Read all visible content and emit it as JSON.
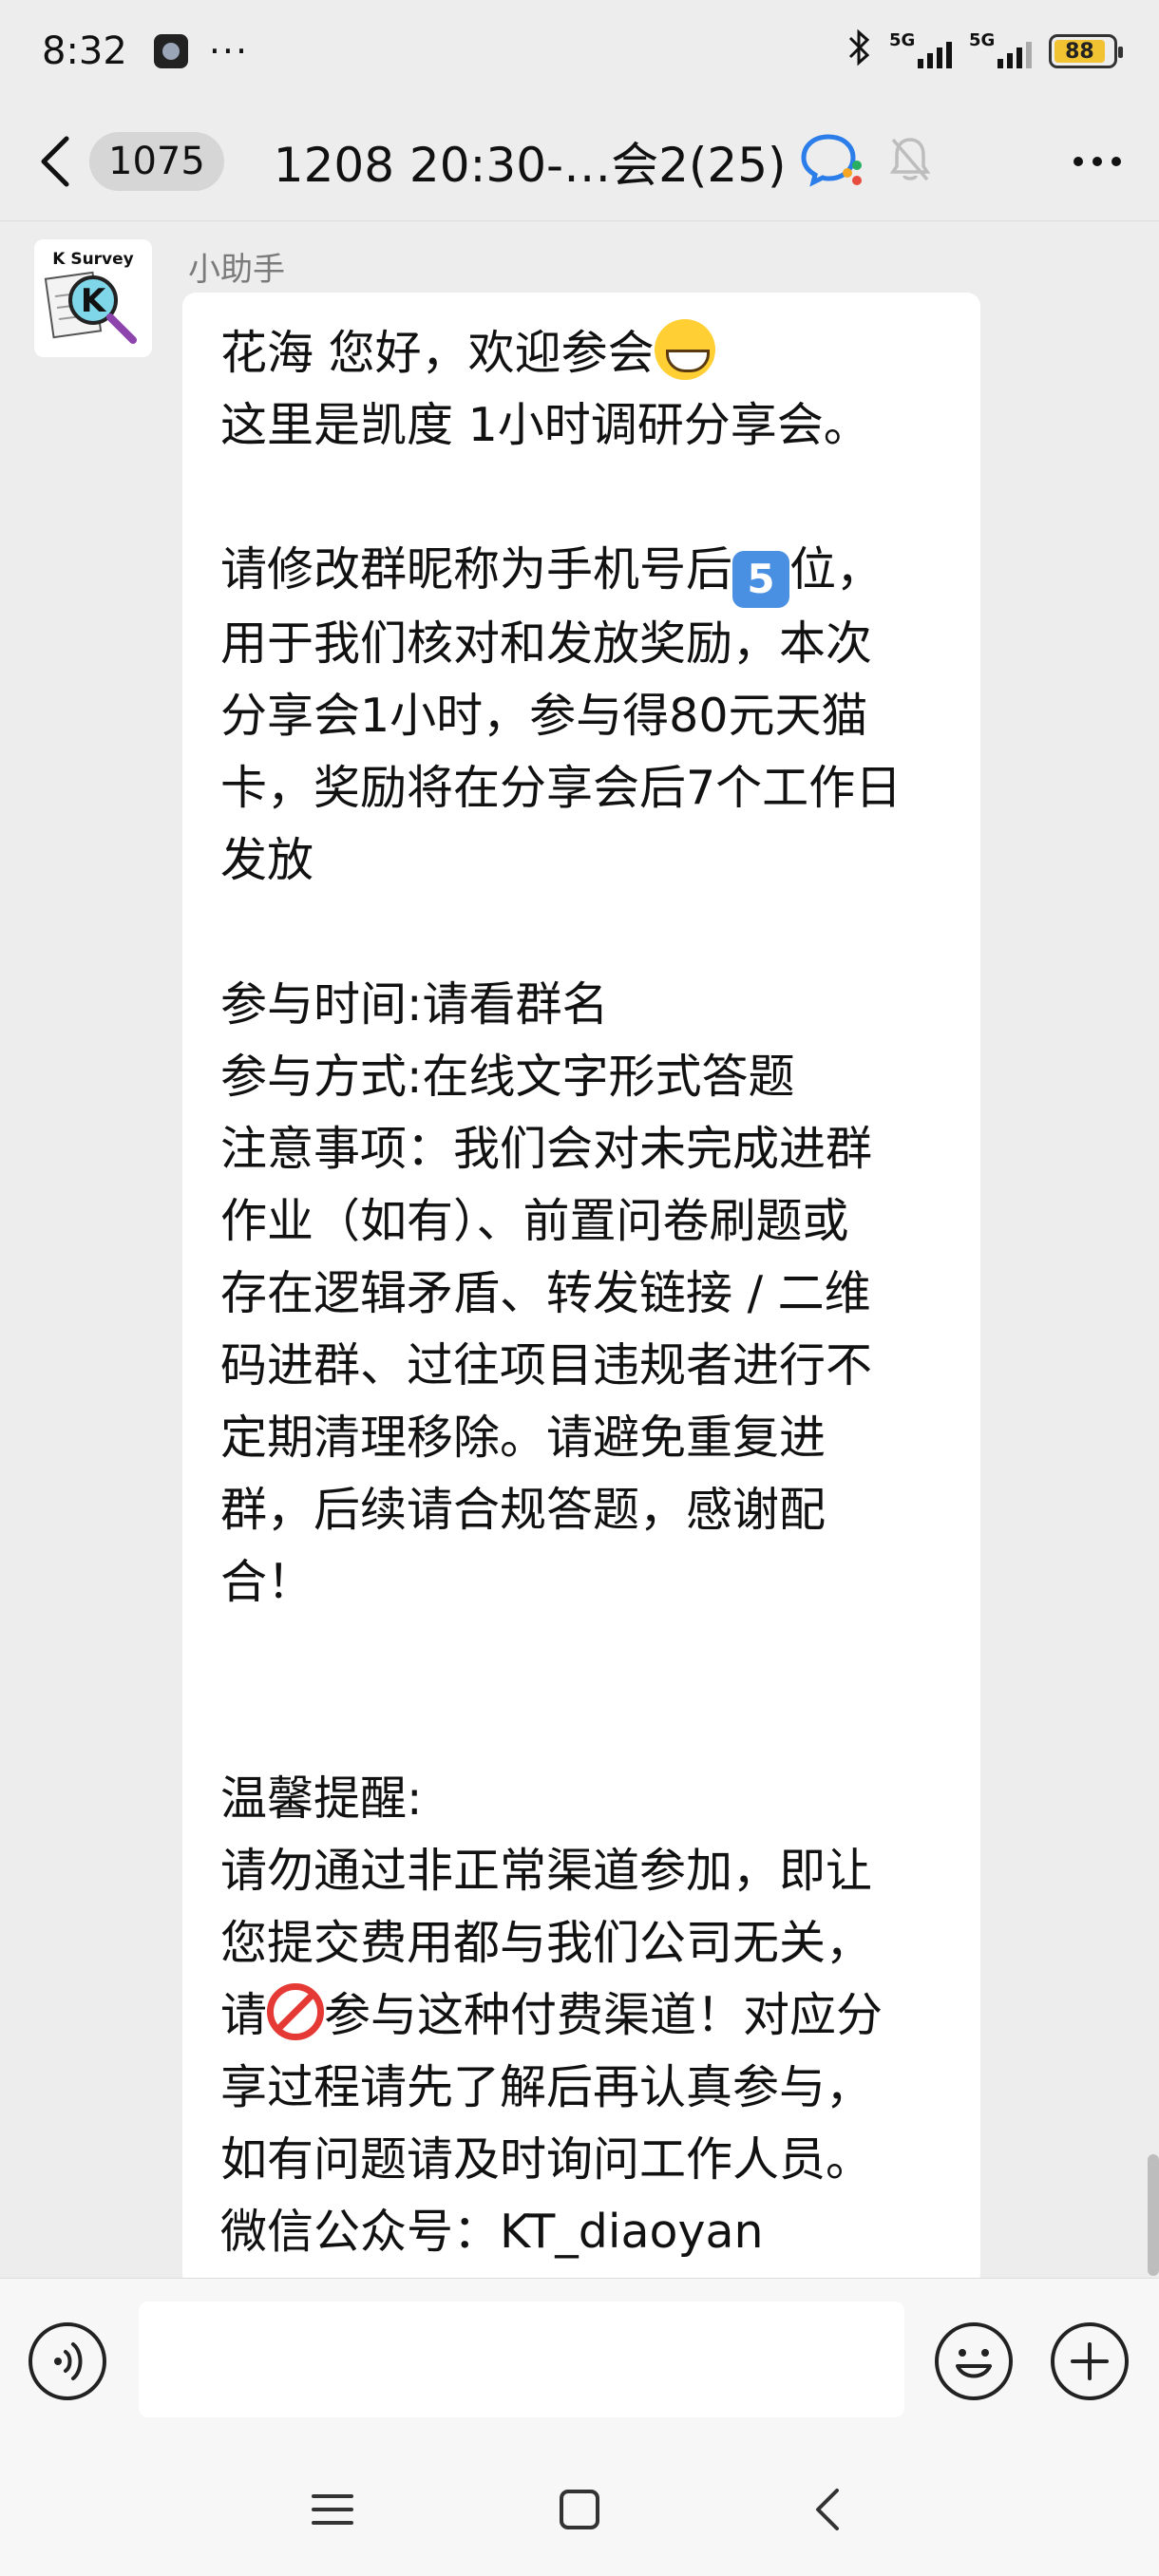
{
  "status_bar": {
    "time": "8:32",
    "more": "···",
    "network_1": "5G",
    "network_2": "5G",
    "battery": "88"
  },
  "header": {
    "unread_count": "1075",
    "title": "1208 20:30-…会2(25)"
  },
  "message": {
    "sender": "小助手",
    "avatar_text": "K Survey",
    "avatar_letter": "K",
    "line_greeting": "花海 您好，欢迎参会",
    "line_intro": "这里是凯度 1小时调研分享会。",
    "para_nickname_a": "请修改群昵称为手机号后",
    "keycap": "5",
    "para_nickname_b": "位，\n用于我们核对和发放奖励，本次\n分享会1小时，参与得80元天猫\n卡，奖励将在分享会后7个工作日\n发放",
    "para_info": "参与时间:请看群名\n参与方式:在线文字形式答题\n注意事项：我们会对未完成进群\n作业（如有）、前置问卷刷题或\n存在逻辑矛盾、转发链接 / 二维\n码进群、过往项目违规者进行不\n定期清理移除。请避免重复进\n群，后续请合规答题，感谢配\n合！",
    "para_tip_a": "温馨提醒:\n请勿通过非正常渠道参加，即让\n您提交费用都与我们公司无关，\n请",
    "para_tip_b": "参与这种付费渠道！对应分\n享过程请先了解后再认真参与，\n如有问题请及时询问工作人员。\n微信公众号：KT_diaoyan"
  },
  "input": {
    "value": ""
  },
  "icons": {
    "back": "back-icon",
    "voice": "voice-icon",
    "emoji": "emoji-icon",
    "plus": "plus-icon",
    "more": "more-icon",
    "mute": "mute-bell-icon",
    "wecom": "wecom-icon"
  },
  "colors": {
    "background": "#ededed",
    "bubble": "#ffffff",
    "battery": "#f1c232"
  }
}
